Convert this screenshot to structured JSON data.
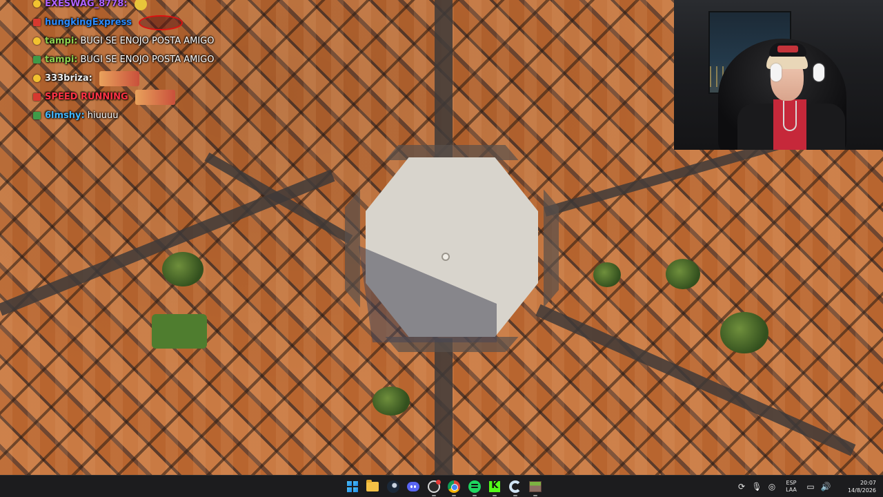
{
  "chat": {
    "messages": [
      {
        "user": "EXESWAG_8778:",
        "user_color": "#b062ff",
        "badge": "gold",
        "text": "",
        "emote": "small"
      },
      {
        "user": "hungkingExpress",
        "user_color": "#2a8bff",
        "badge": "red",
        "text": "",
        "emote": "oval"
      },
      {
        "user": "tampi:",
        "user_color": "#8fd14f",
        "badge": "gold",
        "text": "BUGI SE ENOJO POSTA AMIGO",
        "emote": ""
      },
      {
        "user": "tampi:",
        "user_color": "#8fd14f",
        "badge": "gem",
        "text": "BUGI SE ENOJO POSTA AMIGO",
        "emote": ""
      },
      {
        "user": "333briza:",
        "user_color": "#f0f0f0",
        "badge": "gold",
        "text": "",
        "emote": "wide"
      },
      {
        "user": "SPEED RUNNING",
        "user_color": "#ff3344",
        "badge": "red",
        "text": "",
        "emote": "wide"
      },
      {
        "user": "6lmshy:",
        "user_color": "#41b6ff",
        "badge": "gem",
        "text": "hiuuuu",
        "emote": ""
      }
    ]
  },
  "taskbar": {
    "apps": [
      {
        "name": "start",
        "icon": "windows-start-icon",
        "running": false
      },
      {
        "name": "file-explorer",
        "icon": "folder-icon",
        "running": false
      },
      {
        "name": "steam",
        "icon": "steam-icon",
        "running": false
      },
      {
        "name": "discord",
        "icon": "discord-icon",
        "running": false
      },
      {
        "name": "obs",
        "icon": "obs-icon",
        "running": true
      },
      {
        "name": "chrome",
        "icon": "chrome-icon",
        "running": true
      },
      {
        "name": "spotify",
        "icon": "spotify-icon",
        "running": true
      },
      {
        "name": "kick",
        "icon": "kick-icon",
        "running": true
      },
      {
        "name": "ccleaner",
        "icon": "ccleaner-icon",
        "running": true
      },
      {
        "name": "minecraft",
        "icon": "minecraft-icon",
        "running": true
      }
    ],
    "tray": {
      "language_line1": "ESP",
      "language_line2": "LAA",
      "time": "20:07",
      "date": "14/8/2026"
    }
  },
  "colors": {
    "taskbar_bg": "#1c1c1e",
    "roof_orange": "#b8652f",
    "piazza": "#d8d4cc"
  }
}
